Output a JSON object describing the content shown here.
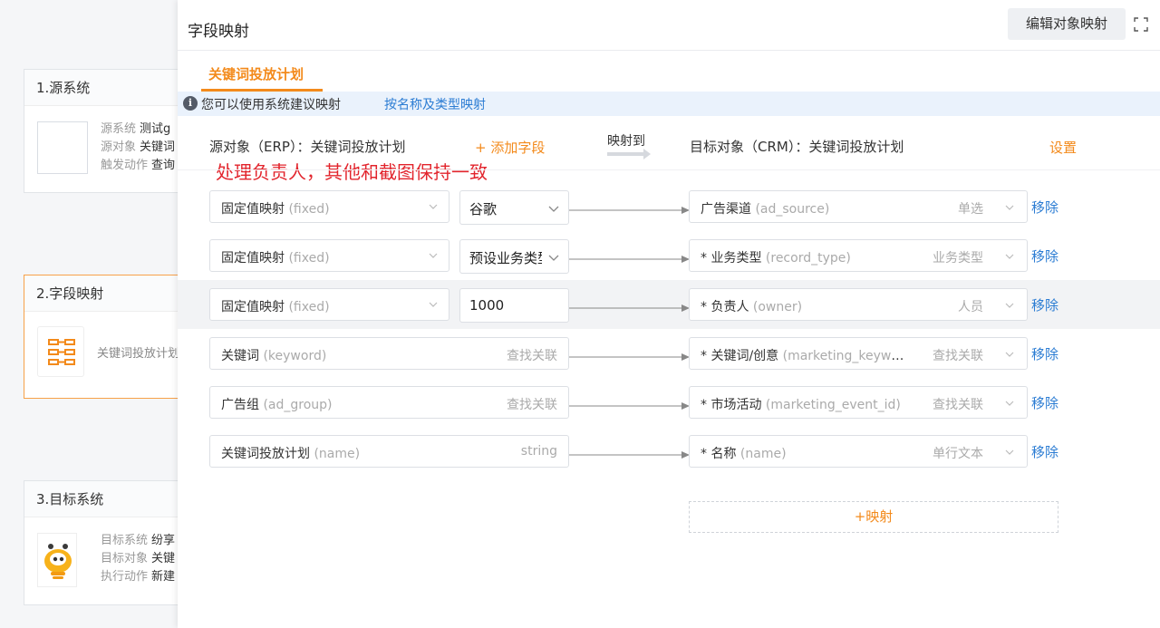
{
  "left_cards": {
    "card1": {
      "header": "1.源系统",
      "labels": [
        "源系统",
        "源对象",
        "触发动作"
      ],
      "values": [
        "测试g",
        "关键词",
        "查询"
      ]
    },
    "card2": {
      "header": "2.字段映射",
      "plan": "关键词投放计划"
    },
    "card3": {
      "header": "3.目标系统",
      "labels": [
        "目标系统",
        "目标对象",
        "执行动作"
      ],
      "values": [
        "纷享",
        "关键",
        "新建"
      ]
    }
  },
  "drawer": {
    "title": "字段映射",
    "edit_button": "编辑对象映射",
    "tab": "关键词投放计划",
    "tip_text": "您可以使用系统建议映射",
    "tip_link": "按名称及类型映射",
    "source_title": "源对象（ERP）：关键词投放计划",
    "add_field": "+ 添加字段",
    "map_to": "映射到",
    "target_title": "目标对象（CRM）：关键词投放计划",
    "settings": "设置",
    "annotation": "处理负责人，其他和截图保持一致",
    "add_mapping": "+映射"
  },
  "rows": [
    {
      "src": "固定值映射",
      "src_en": "(fixed)",
      "value": "谷歌",
      "value_dropdown": true,
      "tgt": "广告渠道",
      "tgt_en": "(ad_source)",
      "tgt_type": "单选",
      "remove": "移除"
    },
    {
      "src": "固定值映射",
      "src_en": "(fixed)",
      "value": "预设业务类型",
      "value_dropdown": true,
      "tgt": "* 业务类型",
      "tgt_en": "(record_type)",
      "tgt_type": "业务类型",
      "remove": "移除"
    },
    {
      "src": "固定值映射",
      "src_en": "(fixed)",
      "value": "1000",
      "value_dropdown": false,
      "tgt": "* 负责人",
      "tgt_en": "(owner)",
      "tgt_type": "人员",
      "remove": "移除"
    },
    {
      "src": "关键词",
      "src_en": "(keyword)",
      "src_type": "查找关联",
      "tgt": "* 关键词/创意",
      "tgt_en": "(marketing_keyword_id)",
      "tgt_type": "查找关联",
      "remove": "移除"
    },
    {
      "src": "广告组",
      "src_en": "(ad_group)",
      "src_type": "查找关联",
      "tgt": "* 市场活动",
      "tgt_en": "(marketing_event_id)",
      "tgt_type": "查找关联",
      "remove": "移除"
    },
    {
      "src": "关键词投放计划",
      "src_en": "(name)",
      "src_type": "string",
      "tgt": "* 名称",
      "tgt_en": "(name)",
      "tgt_type": "单行文本",
      "remove": "移除"
    }
  ],
  "colors": {
    "accent": "#f38a1b",
    "link": "#2b7cd3",
    "annotation": "#e2242c"
  }
}
